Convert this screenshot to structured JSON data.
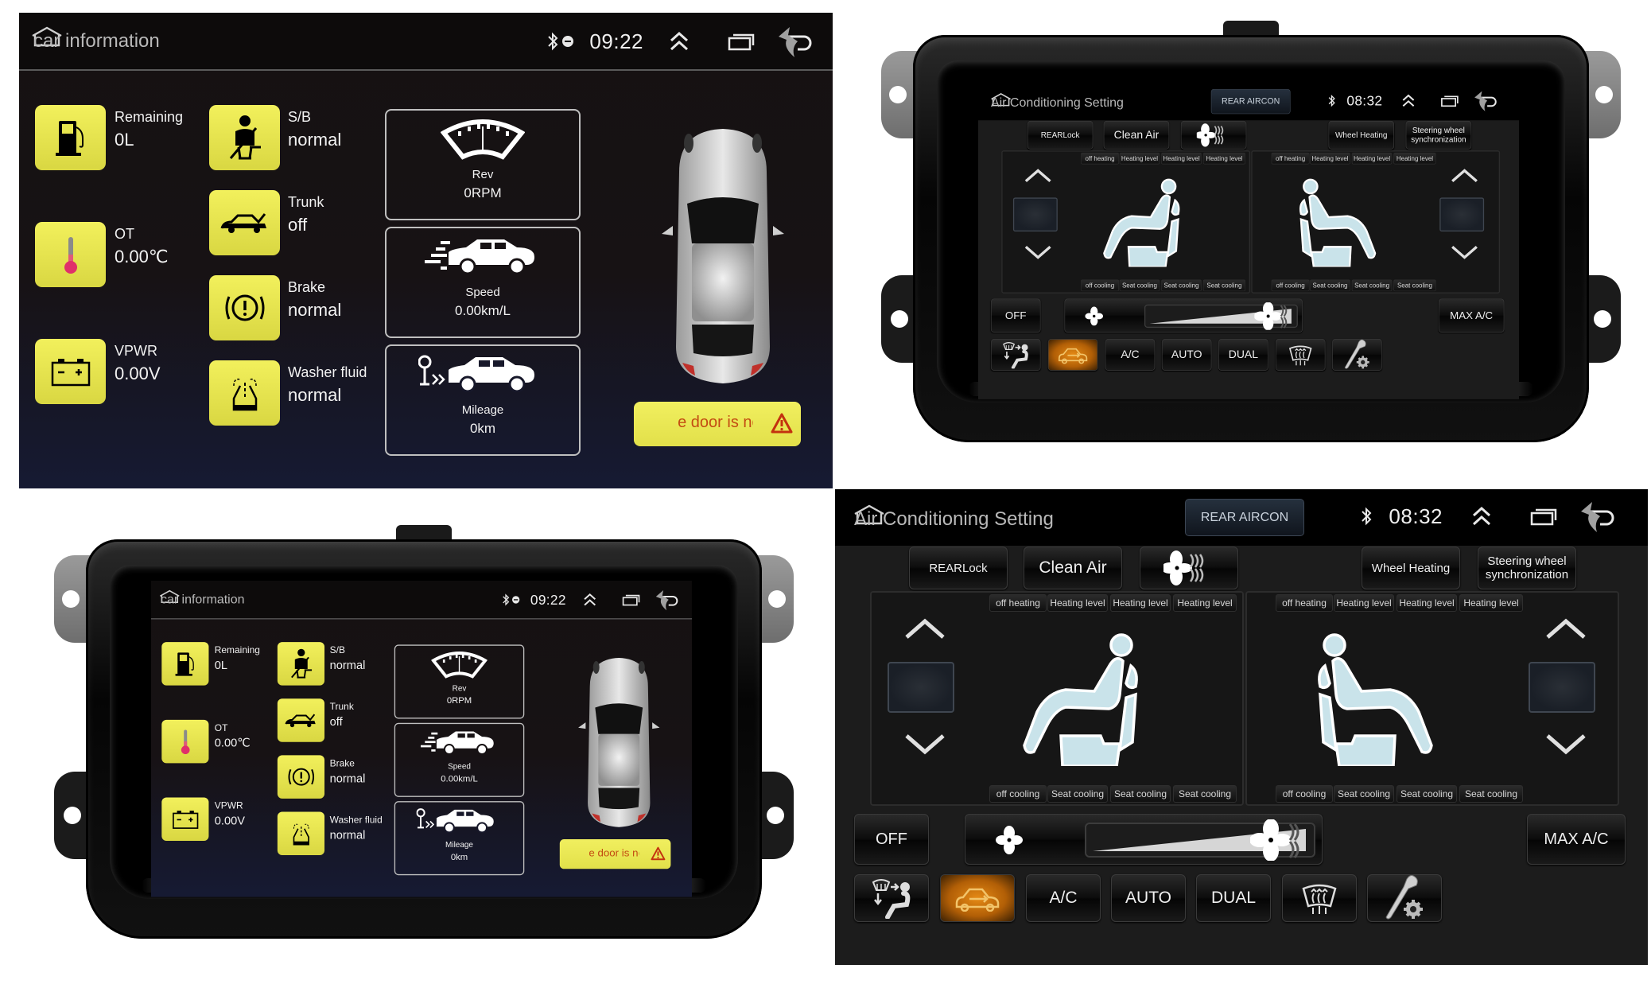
{
  "car_info": {
    "title": "car information",
    "status": {
      "time": "09:22",
      "bluetooth_icon": "bluetooth-icon",
      "recording_icon": "dnd-icon"
    },
    "items": [
      {
        "id": "remaining",
        "label": "Remaining",
        "value": "0L",
        "icon": "fuel-pump-icon"
      },
      {
        "id": "ot",
        "label": "OT",
        "value": "0.00℃",
        "icon": "thermometer-icon"
      },
      {
        "id": "vpwr",
        "label": "VPWR",
        "value": "0.00V",
        "icon": "battery-icon"
      },
      {
        "id": "sb",
        "label": "S/B",
        "value": "normal",
        "icon": "seatbelt-icon"
      },
      {
        "id": "trunk",
        "label": "Trunk",
        "value": "off",
        "icon": "trunk-open-icon"
      },
      {
        "id": "brake",
        "label": "Brake",
        "value": "normal",
        "icon": "brake-warning-icon"
      },
      {
        "id": "washer",
        "label": "Washer fluid",
        "value": "normal",
        "icon": "washer-fluid-icon"
      }
    ],
    "gauges": [
      {
        "id": "rev",
        "label": "Rev",
        "value": "0RPM",
        "icon": "tachometer-icon"
      },
      {
        "id": "speed",
        "label": "Speed",
        "value": "0.00km/L",
        "icon": "speeding-car-icon"
      },
      {
        "id": "mileage",
        "label": "Mileage",
        "value": "0km",
        "icon": "mileage-car-icon"
      }
    ],
    "warning": {
      "text": "he door is not",
      "icon": "warning-triangle-icon"
    },
    "colors": {
      "tile": "#e8e64e",
      "warning_text": "#c34b12"
    }
  },
  "ac": {
    "title": "Air Conditioning Setting",
    "rear_aircon_label": "REAR AIRCON",
    "status": {
      "time": "08:32"
    },
    "top_buttons": {
      "rear_lock": "REARLock",
      "clean_air": "Clean Air",
      "wheel_heating": "Wheel Heating",
      "steering_sync": "Steering wheel synchronization"
    },
    "left_seat": {
      "heating": [
        "off heating",
        "Heating level",
        "Heating level",
        "Heating level"
      ],
      "cooling": [
        "off cooling",
        "Seat cooling",
        "Seat cooling",
        "Seat cooling"
      ],
      "temperature": ""
    },
    "right_seat": {
      "heating": [
        "off heating",
        "Heating level",
        "Heating level",
        "Heating level"
      ],
      "cooling": [
        "off cooling",
        "Seat cooling",
        "Seat cooling",
        "Seat cooling"
      ],
      "temperature": ""
    },
    "fan": {
      "off_label": "OFF",
      "max_label": "MAX  A/C",
      "level": 1.0
    },
    "bottom_buttons": [
      {
        "id": "airflow",
        "label": "",
        "icon": "airflow-direction-icon",
        "active": false
      },
      {
        "id": "recirc",
        "label": "",
        "icon": "recirculation-car-icon",
        "active": true
      },
      {
        "id": "ac",
        "label": "A/C",
        "icon": "",
        "active": false
      },
      {
        "id": "auto",
        "label": "AUTO",
        "icon": "",
        "active": false
      },
      {
        "id": "dual",
        "label": "DUAL",
        "icon": "",
        "active": false
      },
      {
        "id": "defrost",
        "label": "",
        "icon": "windshield-defrost-icon",
        "active": false
      },
      {
        "id": "settings",
        "label": "",
        "icon": "wrench-gear-icon",
        "active": false
      }
    ],
    "colors": {
      "active": "#e58a16"
    }
  }
}
